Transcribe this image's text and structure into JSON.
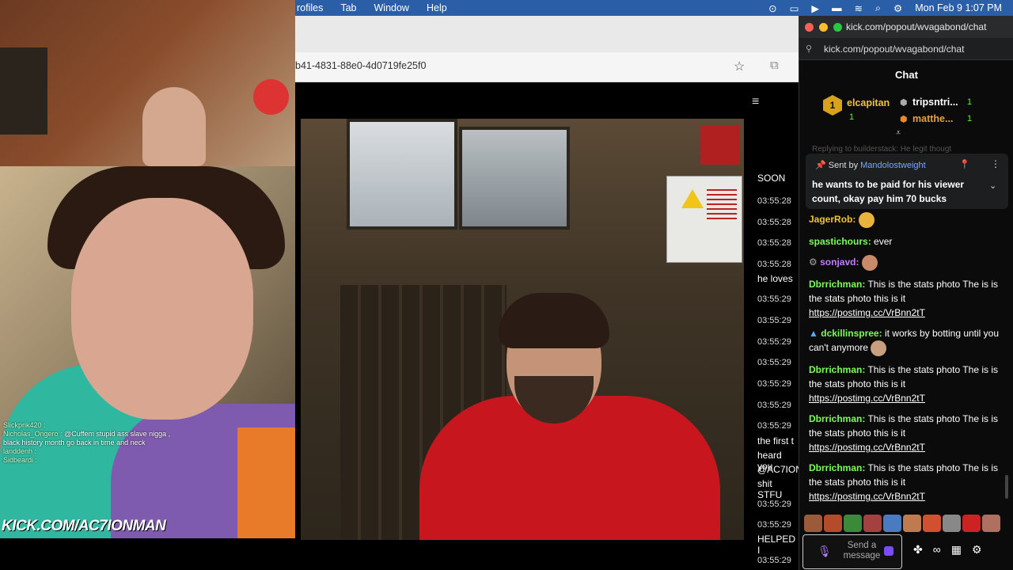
{
  "menubar": {
    "items": [
      "rofiles",
      "Tab",
      "Window",
      "Help"
    ],
    "clock": "Mon Feb 9  1:07 PM"
  },
  "browser": {
    "url_fragment": "b41-4831-88e0-4d0719fe25f0"
  },
  "left_cam": {
    "chat_lines": [
      {
        "user": "Slickprik420 :",
        "text": ""
      },
      {
        "user": "Nicholas_Ongero :",
        "text": "@Cuffem stupid ass slave nigga , black history month go back in time and neck"
      },
      {
        "user": "landdenh :",
        "text": ""
      },
      {
        "user": "Sidbeardi :",
        "text": ""
      }
    ],
    "watermark": "KICK.COM/AC7IONMAN"
  },
  "strip": {
    "soon": "SOON",
    "timestamps": [
      "03:55:28",
      "03:55:28",
      "03:55:28",
      "03:55:28",
      "03:55:29",
      "03:55:29",
      "03:55:29",
      "03:55:29",
      "03:55:29",
      "03:55:29",
      "03:55:29",
      "03:55:29",
      "03:55:29",
      "03:55:29"
    ],
    "snippets": [
      "he loves",
      "the first t",
      "heard you",
      "@AC7ION",
      "shit STFU",
      "HELPED I"
    ]
  },
  "popout": {
    "window_title": "kick.com/popout/wvagabond/chat",
    "address": "kick.com/popout/wvagabond/chat",
    "header": "Chat",
    "leaderboard": {
      "rank_badge": "1",
      "top_user": "elcapitan",
      "top_count": "1",
      "others": [
        {
          "name": "tripsntri...",
          "count": "1"
        },
        {
          "name": "matthe...",
          "count": "1"
        }
      ]
    },
    "replying_text": "Replying to builderstack: He legit thougt",
    "pinned": {
      "sent_by_label": "Sent by",
      "sender": "Mandolostweight",
      "message": "he wants to be paid for his viewer count, okay pay him 70 bucks"
    },
    "messages": [
      {
        "user": "JagerRob:",
        "color": "#f2c23a",
        "text": ""
      },
      {
        "user": "spastichours:",
        "color": "#7cfc5c",
        "text": "ever"
      },
      {
        "user": "sonjavd:",
        "color": "#c47cff",
        "text": ""
      },
      {
        "user": "Dbrrichman:",
        "color": "#7cfc5c",
        "text": "This is the stats photo The is is the stats photo this is it",
        "link": "https://postimg.cc/VrBnn2tT"
      },
      {
        "user": "dckillinspree:",
        "color": "#7cfc5c",
        "text": "it works by botting until you can't anymore"
      },
      {
        "user": "Dbrrichman:",
        "color": "#7cfc5c",
        "text": "This is the stats photo The is is the stats photo this is it",
        "link": "https://postimg.cc/VrBnn2tT"
      },
      {
        "user": "Dbrrichman:",
        "color": "#7cfc5c",
        "text": "This is the stats photo The is is the stats photo this is it",
        "link": "https://postimg.cc/VrBnn2tT"
      },
      {
        "user": "Dbrrichman:",
        "color": "#7cfc5c",
        "text": "This is the stats photo The is is the stats photo this is it",
        "link": "https://postimg.cc/VrBnn2tT"
      }
    ],
    "composer_placeholder": "Send a message",
    "colors": {
      "accent": "#53fc18",
      "gold": "#d8a21c"
    }
  }
}
